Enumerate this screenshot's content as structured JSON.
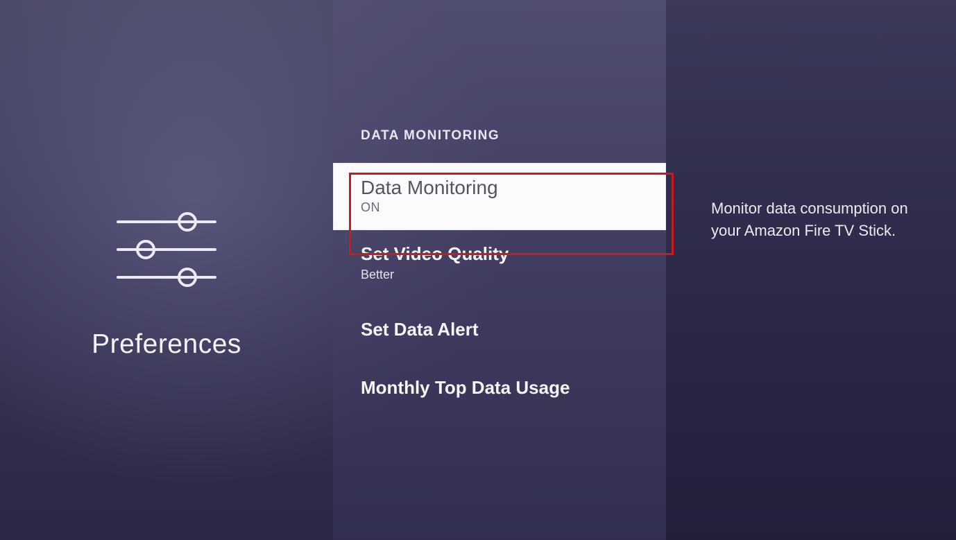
{
  "left": {
    "title": "Preferences"
  },
  "section_header": "DATA MONITORING",
  "menu": {
    "items": [
      {
        "title": "Data Monitoring",
        "sub": "ON",
        "selected": true
      },
      {
        "title": "Set Video Quality",
        "sub": "Better",
        "selected": false
      },
      {
        "title": "Set Data Alert",
        "sub": "",
        "selected": false
      },
      {
        "title": "Monthly Top Data Usage",
        "sub": "",
        "selected": false
      }
    ]
  },
  "description": "Monitor data consumption on your Amazon Fire TV Stick.",
  "highlight_color": "#d01818"
}
